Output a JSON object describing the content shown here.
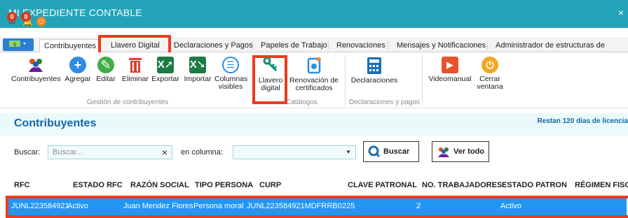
{
  "window": {
    "title": "MI EXPEDIENTE CONTABLE",
    "close": "×",
    "badges": {
      "mail": "0",
      "bell": "0"
    }
  },
  "tabs": [
    "Contribuyentes",
    "Llavero Digital",
    "Declaraciones y Pagos",
    "Papeles de Trabajo",
    "Renovaciones",
    "Mensajes y Notificaciones",
    "Administrador de estructuras de trabajo"
  ],
  "ribbon": {
    "contribuyentes": "Contribuyentes",
    "agregar": "Agregar",
    "editar": "Editar",
    "eliminar": "Eliminar",
    "exportar": "Exportar",
    "importar": "Importar",
    "columnas_1": "Columnas",
    "columnas_2": "visibles",
    "llavero_1": "Llavero",
    "llavero_2": "digital",
    "renovacion_1": "Renovación de",
    "renovacion_2": "certificados",
    "declaraciones": "Declaraciones",
    "videomanual": "Videomanual",
    "cerrar_1": "Cerrar",
    "cerrar_2": "ventana",
    "group_gestion": "Gestión de contribuyentes",
    "group_catalogos": "Catálogos",
    "group_declaraciones": "Declaraciones y pagos"
  },
  "section": {
    "title": "Contribuyentes",
    "note": "Restan 120 días de licencia"
  },
  "search": {
    "label": "Buscar:",
    "placeholder": "Buscar...",
    "clear": "×",
    "column_label": "en columna:",
    "column_value": "",
    "button": "Buscar",
    "show_all": "Ver todo"
  },
  "table": {
    "headers": [
      "RFC",
      "ESTADO RFC",
      "RAZÓN SOCIAL",
      "TIPO PERSONA",
      "CURP",
      "CLAVE PATRONAL",
      "NO. TRABAJADORES",
      "ESTADO PATRON",
      "RÉGIMEN FISCA"
    ],
    "rows": [
      [
        "JUNL223584921",
        "Activo",
        "Juan Mendez Flores",
        "Persona moral",
        "JUNL223584921MDFRRB0",
        "225",
        "2",
        "Activo",
        ""
      ]
    ]
  },
  "colors": {
    "titlebar": "#23a3b8",
    "accent": "#1565a9",
    "selection": "#2196f3",
    "highlight": "#ea3b1f"
  },
  "icons": [
    "mail-icon",
    "bell-icon",
    "power-icon",
    "people-icon",
    "plus-icon",
    "pencil-icon",
    "trash-icon",
    "excel-export-icon",
    "excel-import-icon",
    "list-icon",
    "key-icon",
    "certificate-icon",
    "calculator-icon",
    "play-icon",
    "search-icon"
  ]
}
